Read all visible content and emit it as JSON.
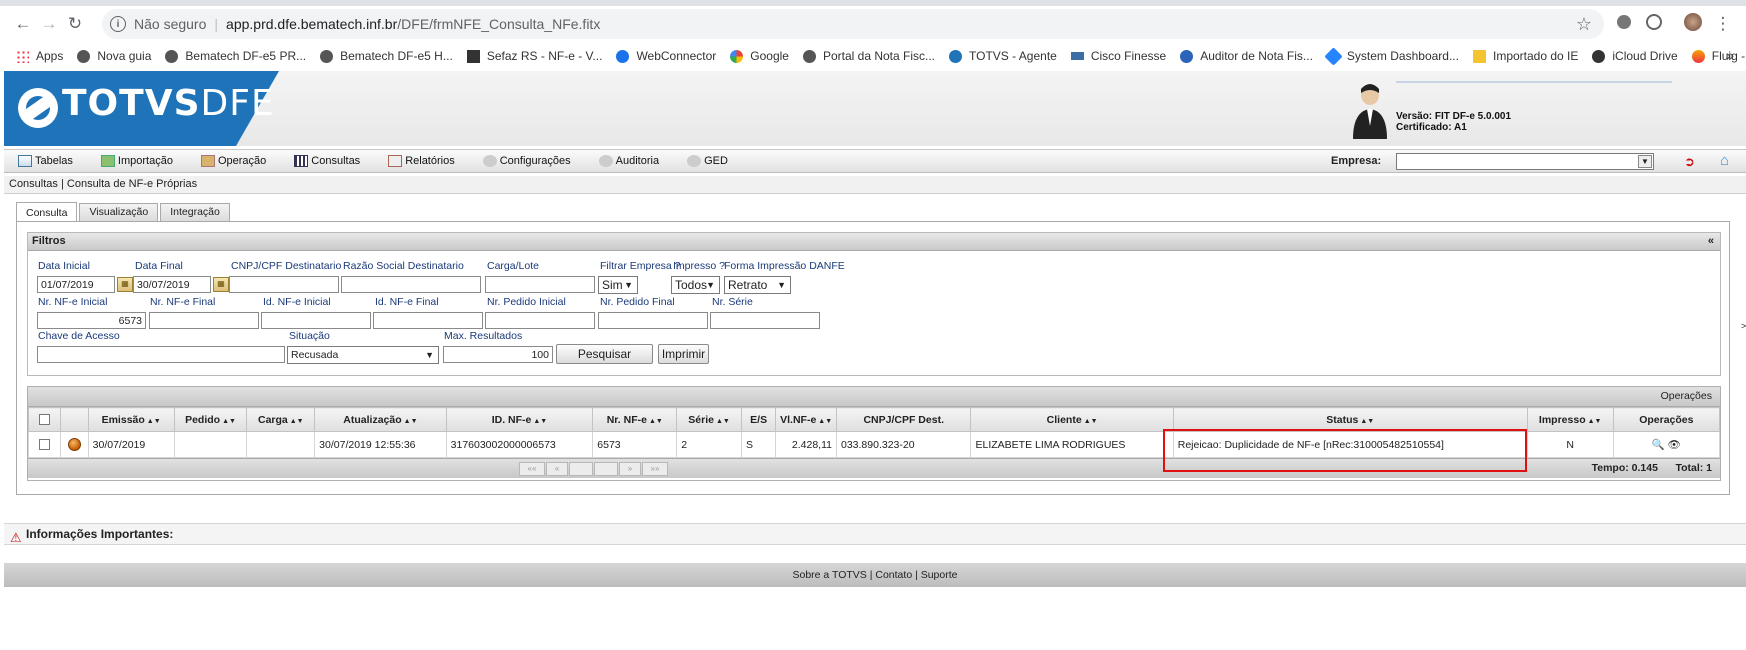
{
  "browser": {
    "security_text": "Não seguro",
    "url_host": "app.prd.dfe.bematech.inf.br",
    "url_path": "/DFE/frmNFE_Consulta_NFe.fitx",
    "bookmarks": [
      "Apps",
      "Nova guia",
      "Bematech DF-e5 PR...",
      "Bematech DF-e5 H...",
      "Sefaz RS - NF-e - V...",
      "WebConnector",
      "Google",
      "Portal da Nota Fisc...",
      "TOTVS - Agente",
      "Cisco Finesse",
      "Auditor de Nota Fis...",
      "System Dashboard...",
      "Importado do IE",
      "iCloud Drive",
      "Fluig - Home"
    ],
    "more": "»"
  },
  "header": {
    "logo_main": "TOTVS",
    "logo_sub": "DFE",
    "version": "Versão: FIT DF-e 5.0.001",
    "certificate": "Certificado: A1"
  },
  "menu": {
    "items": [
      "Tabelas",
      "Importação",
      "Operação",
      "Consultas",
      "Relatórios",
      "Configurações",
      "Auditoria",
      "GED"
    ],
    "empresa_label": "Empresa:"
  },
  "breadcrumb": "Consultas | Consulta de NF-e Próprias",
  "tabs": [
    "Consulta",
    "Visualização",
    "Integração"
  ],
  "filters": {
    "title": "Filtros",
    "collapse": "«",
    "data_inicial_label": "Data Inicial",
    "data_inicial": "01/07/2019",
    "data_final_label": "Data Final",
    "data_final": "30/07/2019",
    "cnpj_label": "CNPJ/CPF Destinatario",
    "razao_label": "Razão Social Destinatario",
    "carga_label": "Carga/Lote",
    "filtrar_empresa_label": "Filtrar Empresa ?",
    "filtrar_empresa": "Sim",
    "impresso_label": "Impresso ?",
    "impresso": "Todos",
    "forma_label": "Forma Impressão DANFE",
    "forma": "Retrato",
    "nr_inicial_label": "Nr. NF-e Inicial",
    "nr_inicial": "6573",
    "nr_final_label": "Nr. NF-e Final",
    "id_inicial_label": "Id. NF-e Inicial",
    "id_final_label": "Id. NF-e Final",
    "pedido_inicial_label": "Nr. Pedido Inicial",
    "pedido_final_label": "Nr. Pedido Final",
    "serie_label": "Nr. Série",
    "chave_label": "Chave de Acesso",
    "situacao_label": "Situação",
    "situacao": "Recusada",
    "max_label": "Max. Resultados",
    "max": "100",
    "pesquisar": "Pesquisar",
    "imprimir": "Imprimir"
  },
  "grid": {
    "top_label": "Operações",
    "columns": [
      "Emissão",
      "Pedido",
      "Carga",
      "Atualização",
      "ID. NF-e",
      "Nr. NF-e",
      "Série",
      "E/S",
      "Vl.NF-e",
      "CNPJ/CPF Dest.",
      "Cliente",
      "Status",
      "Impresso",
      "Operações"
    ],
    "row": {
      "emissao": "30/07/2019",
      "pedido": "",
      "carga": "",
      "atualizacao": "30/07/2019 12:55:36",
      "id": "317603002000006573",
      "nr": "6573",
      "serie": "2",
      "es": "S",
      "valor": "2.428,11",
      "cnpj": "033.890.323-20",
      "cliente": "ELIZABETE LIMA RODRIGUES",
      "status": "Rejeicao: Duplicidade de NF-e [nRec:310005482510554]",
      "impresso": "N"
    },
    "pager": [
      "««",
      "«",
      "",
      "",
      "»",
      "»»"
    ],
    "tempo": "Tempo: 0.145",
    "total": "Total: 1"
  },
  "info_title": "Informações Importantes:",
  "footer": "Sobre a TOTVS | Contato | Suporte",
  "colors": {
    "logo_blue": "#1f74b9",
    "highlight_red": "#e01010",
    "label_blue": "#1b3a7a"
  }
}
